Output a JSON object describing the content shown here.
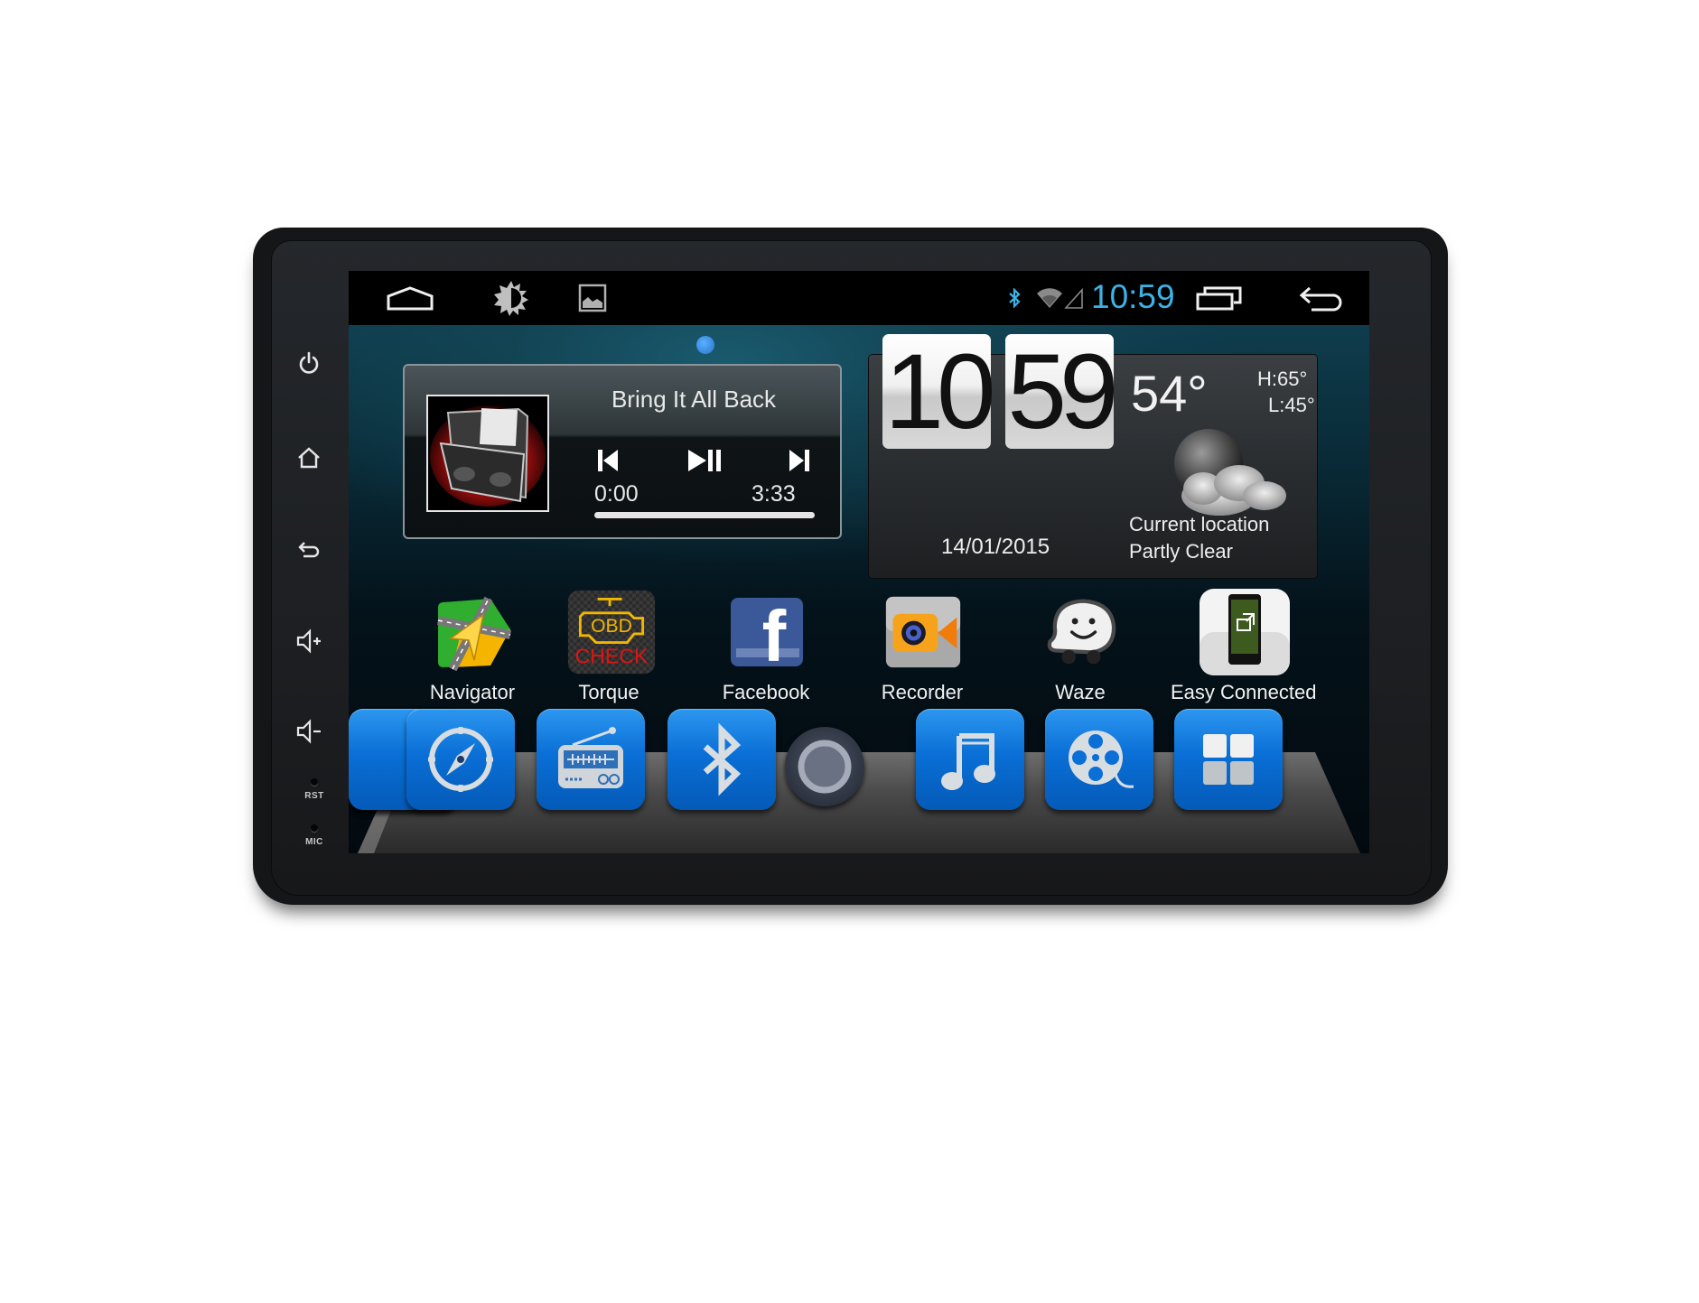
{
  "device": {
    "side_buttons": [
      {
        "name": "power",
        "icon": "power-icon"
      },
      {
        "name": "home",
        "icon": "home-icon"
      },
      {
        "name": "back",
        "icon": "back-icon"
      },
      {
        "name": "volume-up",
        "icon": "volume-up-icon"
      },
      {
        "name": "volume-down",
        "icon": "volume-down-icon"
      }
    ],
    "rst_label": "RST",
    "mic_label": "MIC"
  },
  "status_bar": {
    "left_icons": [
      "home-icon",
      "brightness-icon",
      "gallery-icon"
    ],
    "right_icons": [
      "bluetooth-icon",
      "wifi-icon",
      "signal-icon"
    ],
    "time": "10:59",
    "time_color": "#3cb2e6",
    "nav_icons": [
      "recent-apps-icon",
      "back-icon"
    ]
  },
  "music_widget": {
    "title": "Bring It All Back",
    "current_time": "0:00",
    "total_time": "3:33",
    "progress_fraction": 0.0,
    "controls": [
      "previous",
      "play-pause",
      "next"
    ]
  },
  "clock_weather_widget": {
    "hours": "10",
    "minutes": "59",
    "temperature": "54°",
    "high": "H:65°",
    "low": "L:45°",
    "date": "14/01/2015",
    "location": "Current location",
    "condition": "Partly Clear",
    "weather_icon": "partly-cloudy-night-icon"
  },
  "apps": [
    {
      "label": "Navigator",
      "icon": "navigator-icon"
    },
    {
      "label": "Torque",
      "icon": "obd-check-icon",
      "icon_text_top": "OBD",
      "icon_text_bottom": "CHECK"
    },
    {
      "label": "Facebook",
      "icon": "facebook-icon",
      "icon_text": "f"
    },
    {
      "label": "Recorder",
      "icon": "video-recorder-icon"
    },
    {
      "label": "Waze",
      "icon": "waze-icon"
    },
    {
      "label": "Easy Connected",
      "icon": "phone-link-icon"
    }
  ],
  "dock": [
    {
      "name": "navigation",
      "icon": "compass-icon"
    },
    {
      "name": "radio",
      "icon": "radio-icon"
    },
    {
      "name": "bluetooth",
      "icon": "bluetooth-icon"
    },
    {
      "name": "home",
      "icon": "home-circle-icon"
    },
    {
      "name": "music",
      "icon": "music-note-icon"
    },
    {
      "name": "video",
      "icon": "film-reel-icon"
    },
    {
      "name": "all-apps",
      "icon": "app-grid-icon"
    }
  ],
  "colors": {
    "dock_blue": "#0a6fd6",
    "accent_blue": "#3cb2e6",
    "page_dot": "#3a8ee6"
  }
}
